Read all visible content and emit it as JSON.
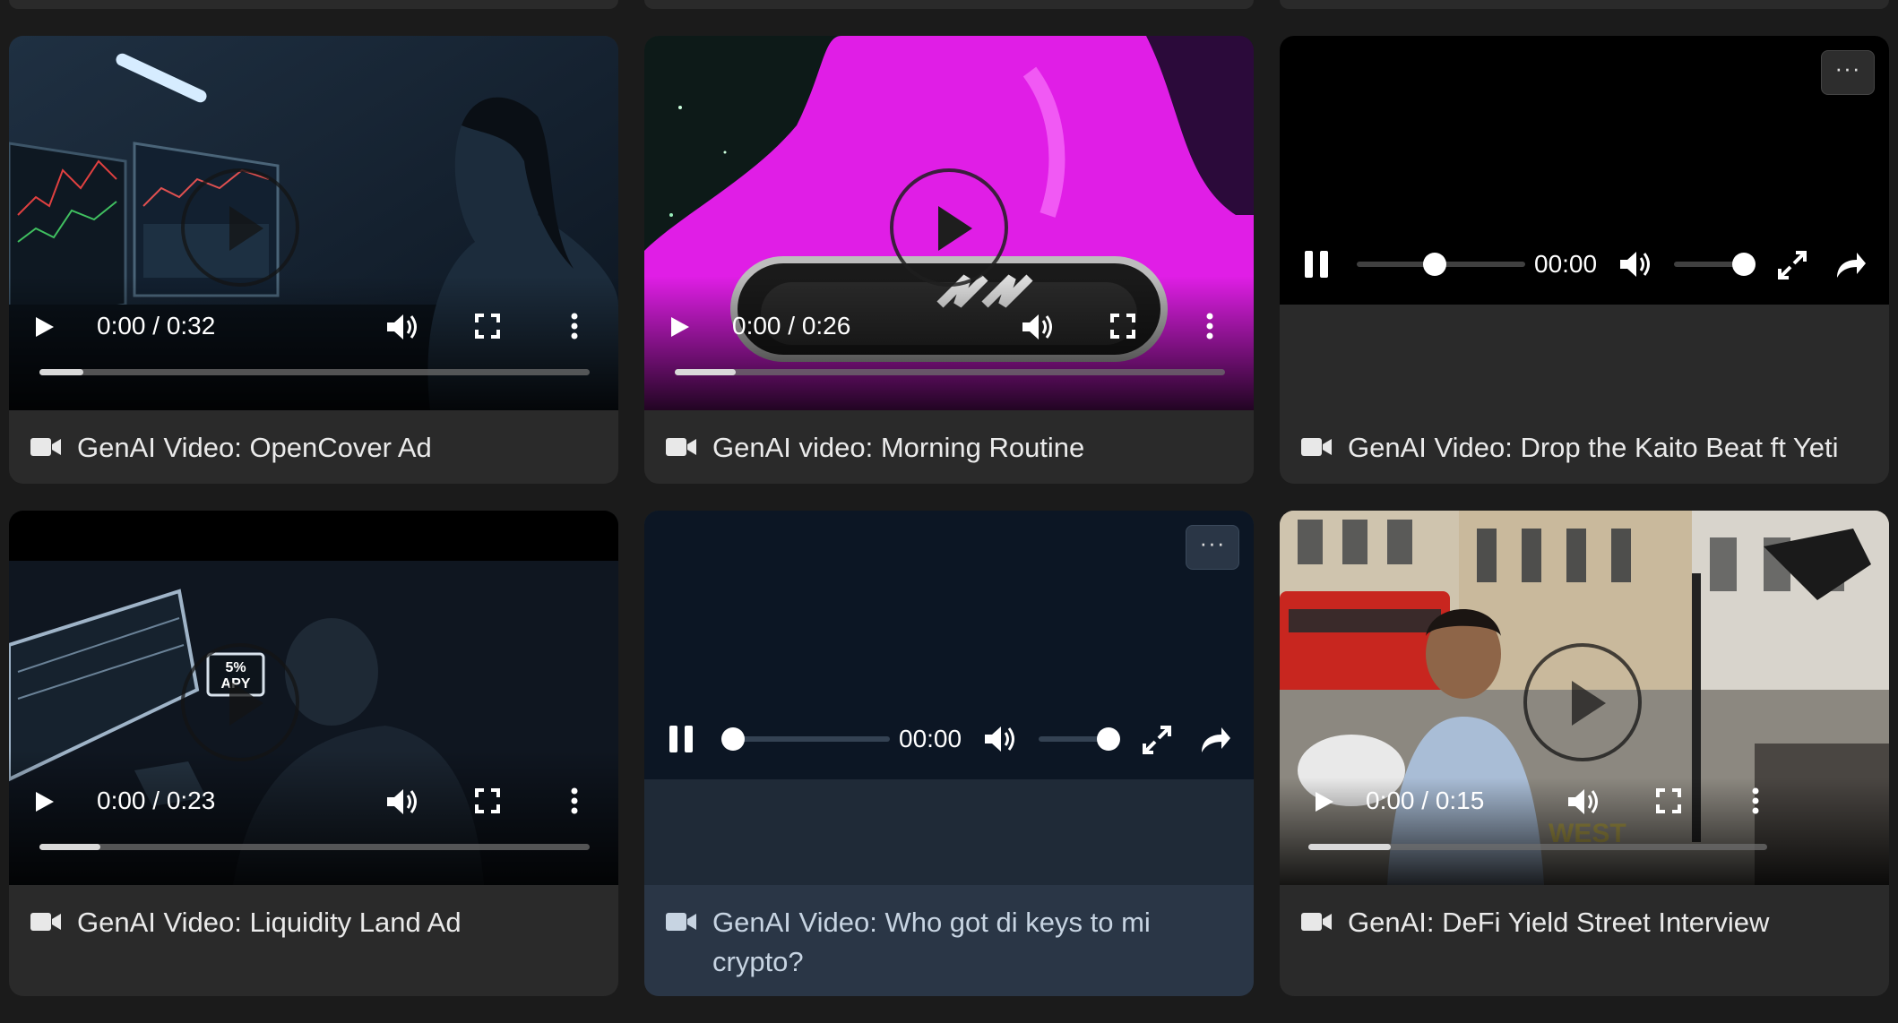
{
  "videos": [
    {
      "title": "GenAI Video: OpenCover Ad",
      "time": "0:00 / 0:32",
      "state": "paused",
      "buffered": 0.08
    },
    {
      "title": "GenAI video: Morning Routine",
      "time": "0:00 / 0:26",
      "state": "paused",
      "buffered": 0.11
    },
    {
      "title": "GenAI Video: Drop the Kaito Beat ft Yeti",
      "time": "00:00",
      "state": "playing",
      "more_label": "···"
    },
    {
      "title": "GenAI Video: Liquidity Land Ad",
      "time": "0:00 / 0:23",
      "state": "paused",
      "buffered": 0.11
    },
    {
      "title": "GenAI Video: Who got di keys to mi crypto?",
      "time": "00:00",
      "state": "playing",
      "more_label": "···",
      "highlighted": true
    },
    {
      "title": "GenAI: DeFi Yield Street Interview",
      "time": "0:00 / 0:15",
      "state": "paused",
      "buffered": 0.18
    }
  ],
  "icons": {
    "card_title": "video-camera-icon",
    "native_controls": [
      "play-icon",
      "volume-icon",
      "fullscreen-icon",
      "more-vertical-icon"
    ],
    "custom_controls": [
      "pause-icon",
      "volume-icon",
      "expand-icon",
      "share-icon"
    ]
  },
  "colors": {
    "page_bg": "#1b1b1b",
    "card_bg": "#2a2a2a",
    "highlight_card_bg": "#1f2a37",
    "magenta": "#e01ee6"
  }
}
